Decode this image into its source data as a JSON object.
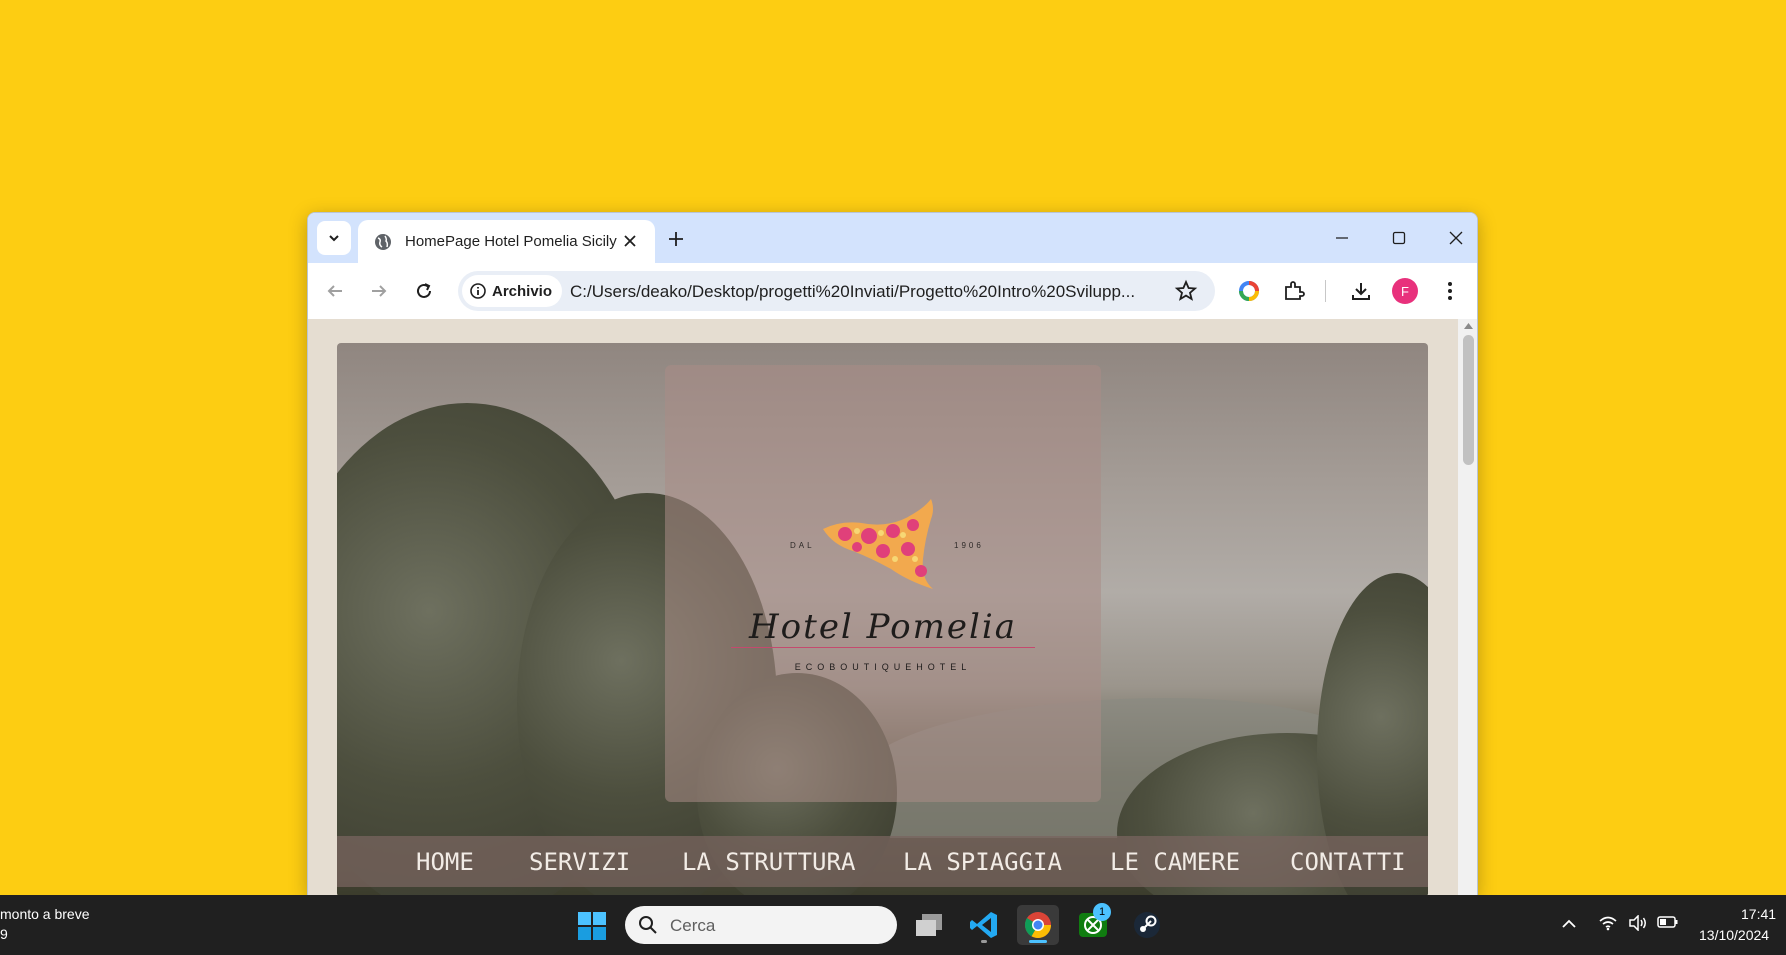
{
  "desktop": {
    "background_color": "#fdcd12"
  },
  "browser": {
    "tab": {
      "title": "HomePage Hotel Pomelia Sicily",
      "icon": "globe-icon"
    },
    "new_tab_icon": "plus-icon",
    "window_controls": [
      "minimize-icon",
      "maximize-icon",
      "close-icon"
    ],
    "site_chip_label": "Archivio",
    "url": "C:/Users/deako/Desktop/progetti%20Inviati/Progetto%20Intro%20Svilupp...",
    "profile_initial": "F",
    "accent_color": "#d3e3fd"
  },
  "page": {
    "logo": {
      "since_label": "DAL",
      "year": "1906",
      "name": "Hotel Pomelia",
      "tagline": "ECOBOUTIQUEHOTEL"
    },
    "nav": [
      "HOME",
      "SERVIZI",
      "LA STRUTTURA",
      "LA SPIAGGIA",
      "LE CAMERE",
      "CONTATTI"
    ]
  },
  "taskbar": {
    "notification_line1": "monto a breve",
    "notification_line2": "9",
    "search_placeholder": "Cerca",
    "apps": [
      "task-view-icon",
      "vscode-icon",
      "chrome-icon",
      "xbox-icon",
      "steam-icon"
    ],
    "xbox_badge": "1",
    "time": "17:41",
    "date": "13/10/2024"
  }
}
